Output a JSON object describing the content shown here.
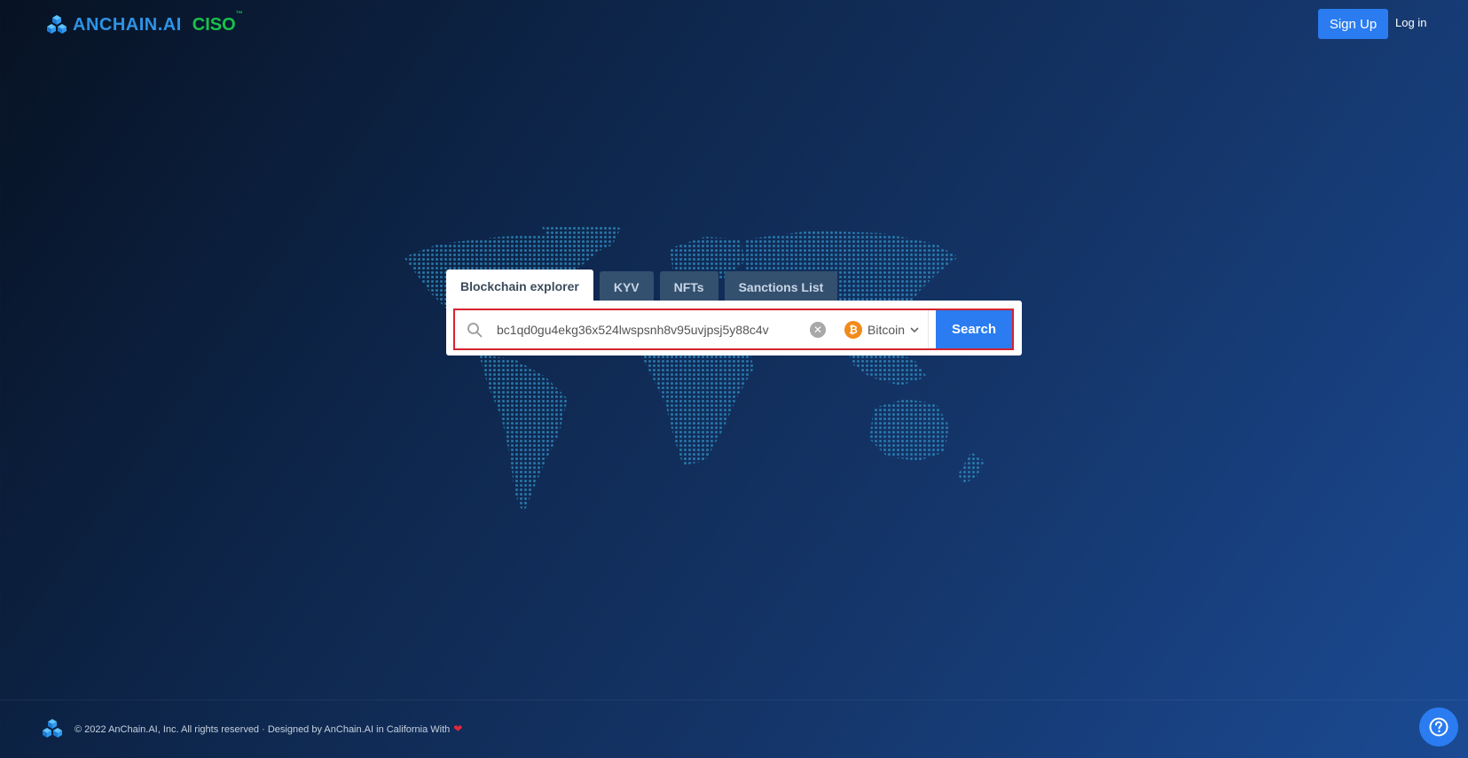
{
  "header": {
    "logo_word": "ANCHAIN.AI",
    "logo_product": "CISO",
    "logo_tm": "™",
    "signup_label": "Sign Up",
    "login_label": "Log in"
  },
  "search": {
    "tabs": [
      {
        "label": "Blockchain explorer",
        "active": true
      },
      {
        "label": "KYV",
        "active": false
      },
      {
        "label": "NFTs",
        "active": false
      },
      {
        "label": "Sanctions List",
        "active": false
      }
    ],
    "query_value": "bc1qd0gu4ekg36x524lwspsnh8v95uvjpsj5y88c4v",
    "chain_selected": "Bitcoin",
    "button_label": "Search"
  },
  "footer": {
    "copyright": "© 2022 AnChain.AI, Inc. All rights reserved · Designed by AnChain.AI in California With"
  },
  "icons": {
    "search": "search-icon",
    "clear": "clear-icon",
    "bitcoin": "bitcoin-icon",
    "chevron": "chevron-down-icon",
    "heart": "heart-icon",
    "help": "question-icon",
    "logo": "cube-logo-icon"
  },
  "colors": {
    "brand_blue": "#2a7cf0",
    "logo_blue": "#2d93e6",
    "ciso_green": "#18c24a",
    "highlight_red": "#d6222e",
    "bitcoin_orange": "#f08b1b"
  }
}
